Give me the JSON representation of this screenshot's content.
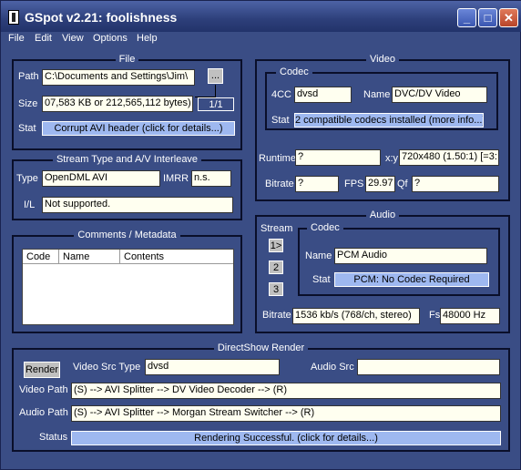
{
  "window": {
    "title": "GSpot v2.21: foolishness",
    "min": "_",
    "max": "□",
    "close": "✕"
  },
  "menu": [
    "File",
    "Edit",
    "View",
    "Options",
    "Help"
  ],
  "file": {
    "title": "File",
    "path_label": "Path",
    "path_value": "C:\\Documents and Settings\\Jim\\",
    "browse_label": "...",
    "size_label": "Size",
    "size_value": "07,583 KB or 212,565,112 bytes)",
    "page_indicator": "1/1",
    "stat_label": "Stat",
    "stat_value": "Corrupt AVI header (click for details...)"
  },
  "stream": {
    "title": "Stream Type and A/V Interleave",
    "type_label": "Type",
    "type_value": "OpenDML AVI",
    "imrr_label": "IMRR",
    "imrr_value": "n.s.",
    "il_label": "I/L",
    "il_value": "Not supported."
  },
  "comments": {
    "title": "Comments / Metadata",
    "columns": [
      "Code",
      "Name",
      "Contents"
    ]
  },
  "video": {
    "title": "Video",
    "codec_title": "Codec",
    "fourcc_label": "4CC",
    "fourcc_value": "dvsd",
    "name_label": "Name",
    "name_value": "DVC/DV Video",
    "stat_label": "Stat",
    "stat_value": "2 compatible codecs installed (more info...)",
    "runtime_label": "Runtime",
    "runtime_value": "?",
    "xy_label": "x:y",
    "xy_value": "720x480 (1.50:1) [=3:",
    "bitrate_label": "Bitrate",
    "bitrate_value": "?",
    "fps_label": "FPS",
    "fps_value": "29.97",
    "qf_label": "Qf",
    "qf_value": "?"
  },
  "audio": {
    "title": "Audio",
    "stream_label": "Stream",
    "streams": [
      "1>",
      "2",
      "3"
    ],
    "codec_title": "Codec",
    "name_label": "Name",
    "name_value": "PCM Audio",
    "stat_label": "Stat",
    "stat_value": "PCM: No Codec Required",
    "bitrate_label": "Bitrate",
    "bitrate_value": "1536 kb/s (768/ch, stereo)",
    "fs_label": "Fs",
    "fs_value": "48000 Hz"
  },
  "directshow": {
    "title": "DirectShow Render",
    "render_label": "Render",
    "vsrc_label": "Video Src Type",
    "vsrc_value": "dvsd",
    "asrc_label": "Audio Src",
    "asrc_value": "",
    "vpath_label": "Video Path",
    "vpath_value": "(S) --> AVI Splitter --> DV Video Decoder --> (R)",
    "apath_label": "Audio Path",
    "apath_value": "(S) --> AVI Splitter --> Morgan Stream Switcher --> (R)",
    "status_label": "Status",
    "status_value": "Rendering Successful.  (click for details...)"
  }
}
